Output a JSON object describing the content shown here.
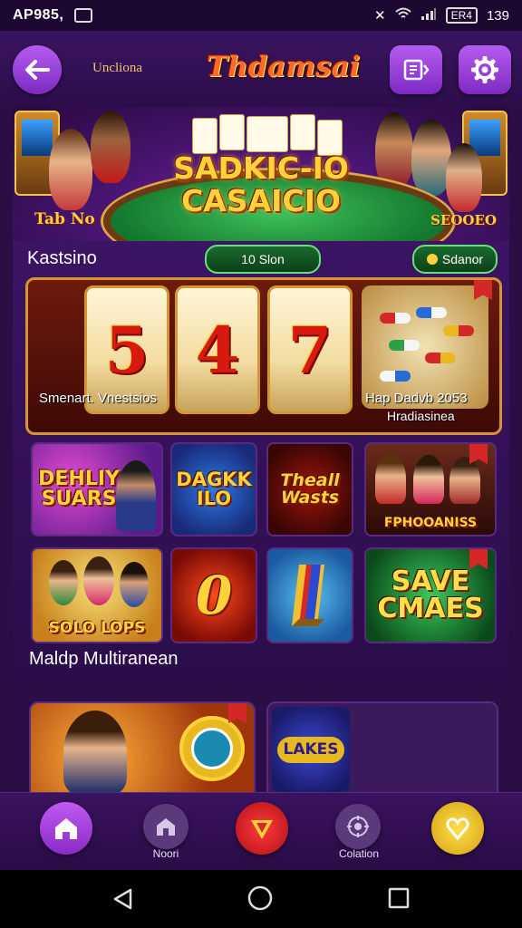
{
  "status_bar": {
    "time": "AP985,",
    "battery": "ER4",
    "level": "139"
  },
  "header": {
    "subtitle": "Uncliona",
    "logo": "Thdamsai"
  },
  "hero": {
    "title_line1": "SADKIC-IO",
    "title_line2": "CASAICIO",
    "left_label": "Tab No",
    "right_label": "SEOOEO"
  },
  "section1": {
    "title": "Kastsino",
    "center_pill": "10 Slon",
    "right_pill": "Sdanor"
  },
  "slot": {
    "reels": [
      "5",
      "4",
      "7"
    ],
    "caption_left": "Smenart. Vnestsios",
    "caption_right1": "Hap Dadvb 2053",
    "caption_right2": "Hradiasinea"
  },
  "games": [
    {
      "text": "DEHLIY SUARS"
    },
    {
      "text": "DAGKK ILO"
    },
    {
      "text": "Theall Wasts"
    },
    {
      "text": "FPHOOANISS"
    },
    {
      "text": "SOLO LOPS"
    },
    {
      "text": "0"
    },
    {
      "text": ""
    },
    {
      "text": "SAVE CMAES"
    }
  ],
  "section2": {
    "title": "Maldp Multiranean"
  },
  "bottom_cards": {
    "right_text": "LAKES"
  },
  "bottom_nav": {
    "items": [
      {
        "label": ""
      },
      {
        "label": "Noori"
      },
      {
        "label": ""
      },
      {
        "label": "Colation"
      },
      {
        "label": ""
      }
    ]
  }
}
